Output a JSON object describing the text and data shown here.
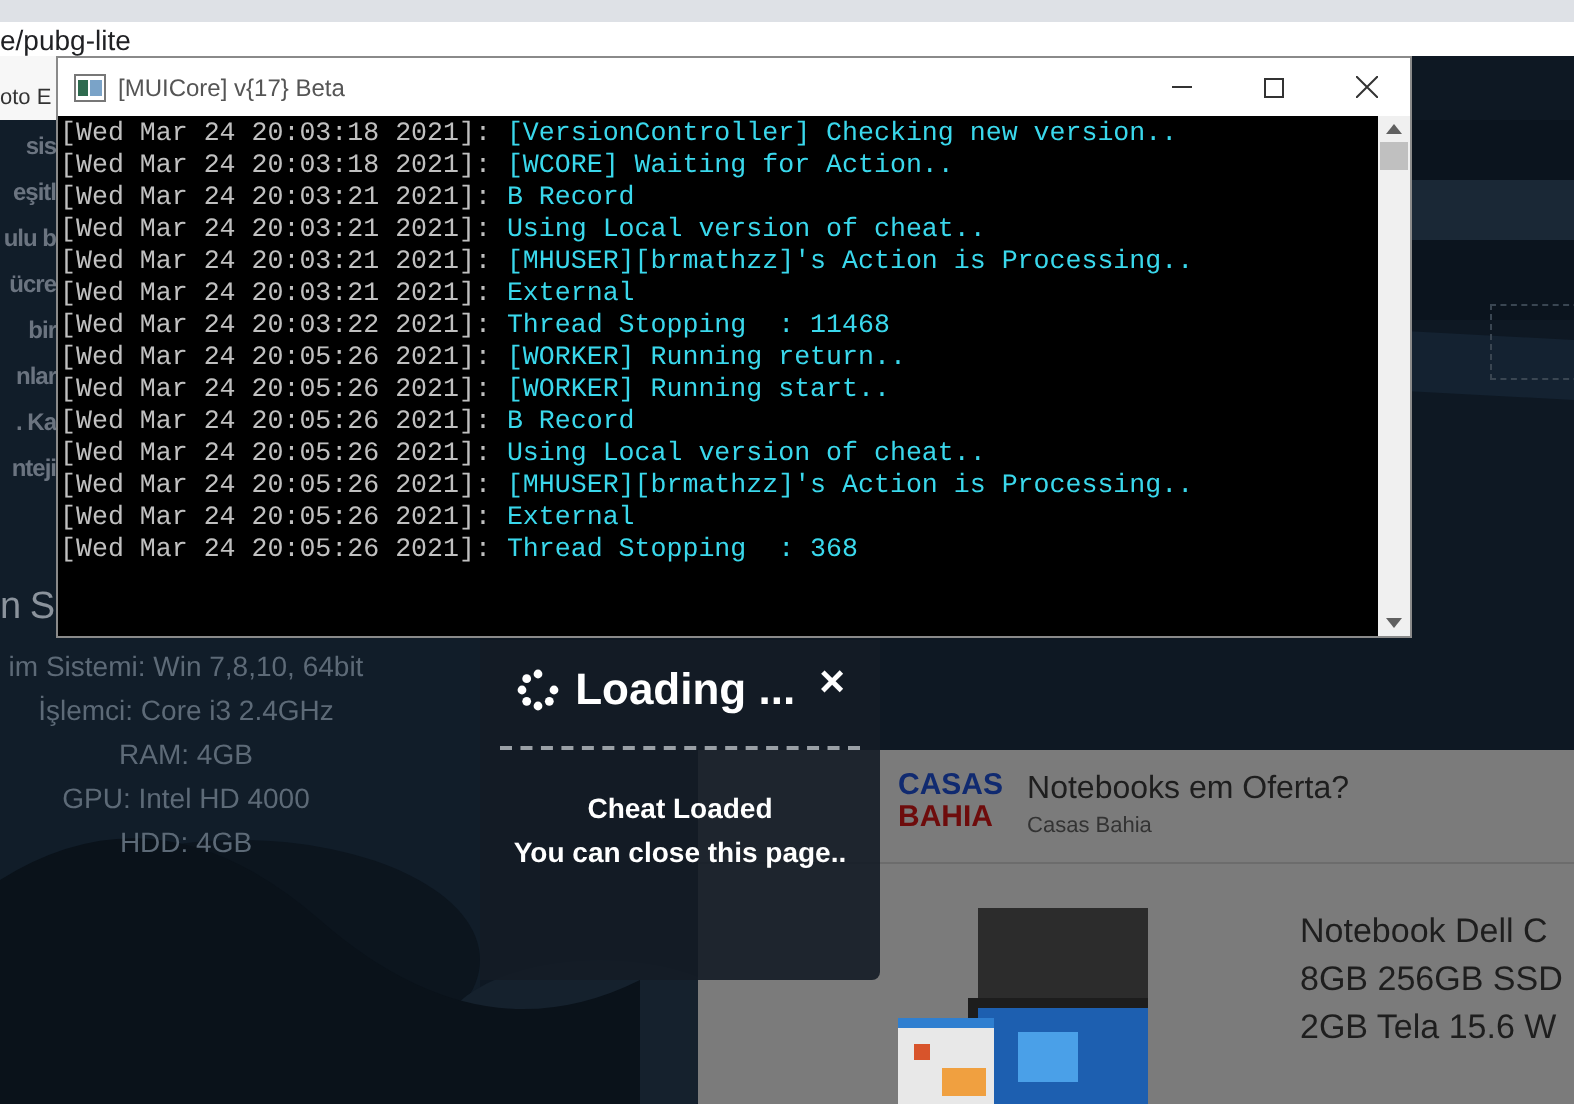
{
  "browser": {
    "address": "e/pubg-lite",
    "bookmark": "oto E"
  },
  "page": {
    "fragments": [
      "sis",
      "eşitl",
      "ulu b",
      "ücre",
      "bir",
      "nlar",
      ". Ka",
      "nteji"
    ],
    "heading": "n S",
    "specs": [
      "im Sistemi: Win 7,8,10, 64bit",
      "İşlemci: Core i3 2.4GHz",
      "RAM: 4GB",
      "GPU: Intel HD 4000",
      "HDD: 4GB"
    ]
  },
  "console_window": {
    "title": "[MUICore] v{17} Beta",
    "lines": [
      {
        "time": "[Wed Mar 24 20:03:18 2021]:",
        "message": "[VersionController] Checking new version.."
      },
      {
        "time": "[Wed Mar 24 20:03:18 2021]:",
        "message": "[WCORE] Waiting for Action.."
      },
      {
        "time": "[Wed Mar 24 20:03:21 2021]:",
        "message": "B Record"
      },
      {
        "time": "[Wed Mar 24 20:03:21 2021]:",
        "message": "Using Local version of cheat.."
      },
      {
        "time": "[Wed Mar 24 20:03:21 2021]:",
        "message": "[MHUSER][brmathzz]'s Action is Processing.."
      },
      {
        "time": "[Wed Mar 24 20:03:21 2021]:",
        "message": "External"
      },
      {
        "time": "[Wed Mar 24 20:03:22 2021]:",
        "message": "Thread Stopping  : 11468"
      },
      {
        "time": "[Wed Mar 24 20:05:26 2021]:",
        "message": "[WORKER] Running return.."
      },
      {
        "time": "[Wed Mar 24 20:05:26 2021]:",
        "message": "[WORKER] Running start.."
      },
      {
        "time": "[Wed Mar 24 20:05:26 2021]:",
        "message": "B Record"
      },
      {
        "time": "[Wed Mar 24 20:05:26 2021]:",
        "message": "Using Local version of cheat.."
      },
      {
        "time": "[Wed Mar 24 20:05:26 2021]:",
        "message": "[MHUSER][brmathzz]'s Action is Processing.."
      },
      {
        "time": "[Wed Mar 24 20:05:26 2021]:",
        "message": "External"
      },
      {
        "time": "[Wed Mar 24 20:05:26 2021]:",
        "message": "Thread Stopping  : 368"
      }
    ]
  },
  "loader": {
    "title": "Loading ...",
    "close": "×",
    "messages": [
      "Cheat Loaded",
      "You can close this page.."
    ]
  },
  "ad": {
    "logo": [
      "CASAS",
      "BAHIA"
    ],
    "title": "Notebooks em Oferta?",
    "advertiser": "Casas Bahia",
    "product_lines": [
      "Notebook Dell C",
      "8GB 256GB SSD",
      "2GB Tela 15.6 W"
    ]
  }
}
